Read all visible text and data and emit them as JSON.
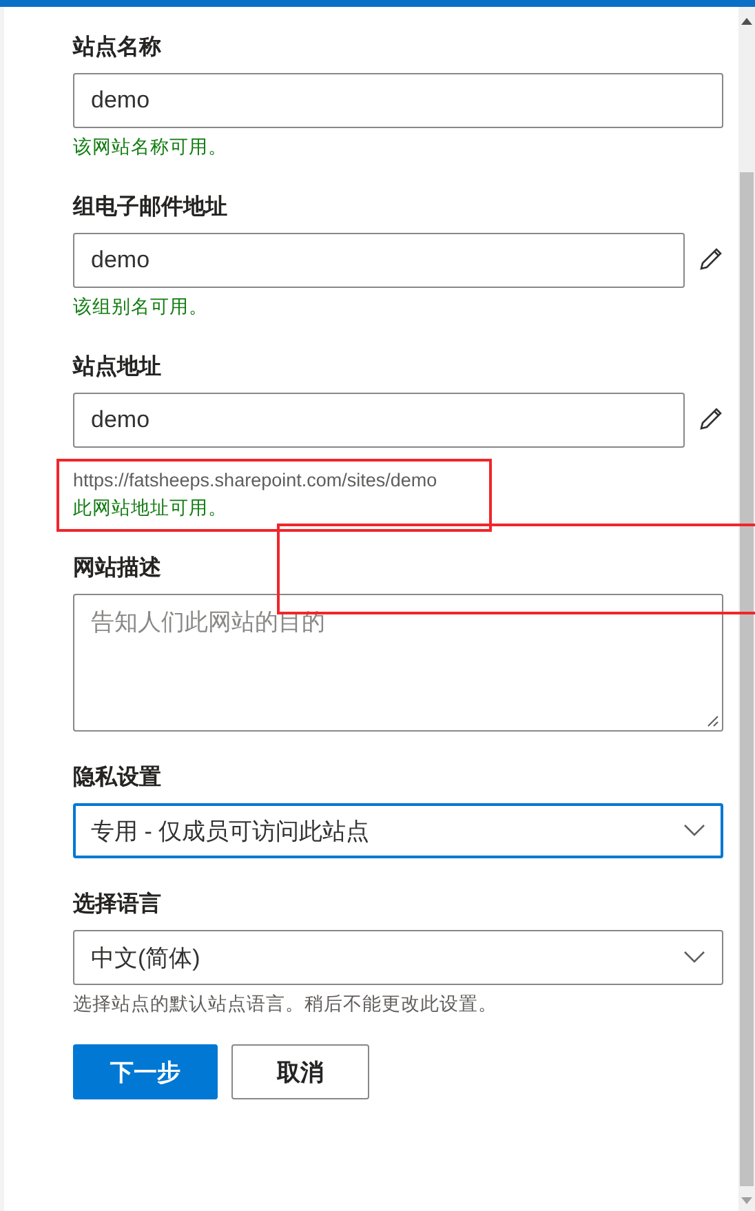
{
  "fields": [
    {
      "kind": "text",
      "label": "站点名称",
      "value": "demo",
      "focused": false,
      "hints": [
        {
          "kind": "status",
          "text": "该网站名称可用。"
        }
      ]
    },
    {
      "kind": "text",
      "label": "组电子邮件地址",
      "value": "demo",
      "editable": true,
      "focused": false,
      "hints": [
        {
          "kind": "status",
          "text": "该组别名可用。"
        }
      ]
    },
    {
      "kind": "text",
      "label": "站点地址",
      "value": "demo",
      "editable": true,
      "focused": false,
      "highlighted": true,
      "hints": [
        {
          "kind": "help",
          "text": "https://fatsheeps.sharepoint.com/sites/demo"
        },
        {
          "kind": "status",
          "text": "此网站地址可用。"
        }
      ]
    },
    {
      "kind": "textarea",
      "label": "网站描述",
      "placeholder": "告知人们此网站的目的",
      "focused": false
    },
    {
      "kind": "select",
      "label": "隐私设置",
      "value": "专用 - 仅成员可访问此站点",
      "focused": true
    },
    {
      "kind": "select",
      "label": "选择语言",
      "value": "中文(简体)",
      "focused": false,
      "hints": [
        {
          "kind": "help",
          "text": "选择站点的默认站点语言。稍后不能更改此设置。"
        }
      ]
    }
  ],
  "buttons": [
    {
      "kind": "primary",
      "label": "下一步"
    },
    {
      "kind": "secondary",
      "label": "取消"
    }
  ],
  "annotations": [
    {
      "kind": "outline"
    }
  ]
}
